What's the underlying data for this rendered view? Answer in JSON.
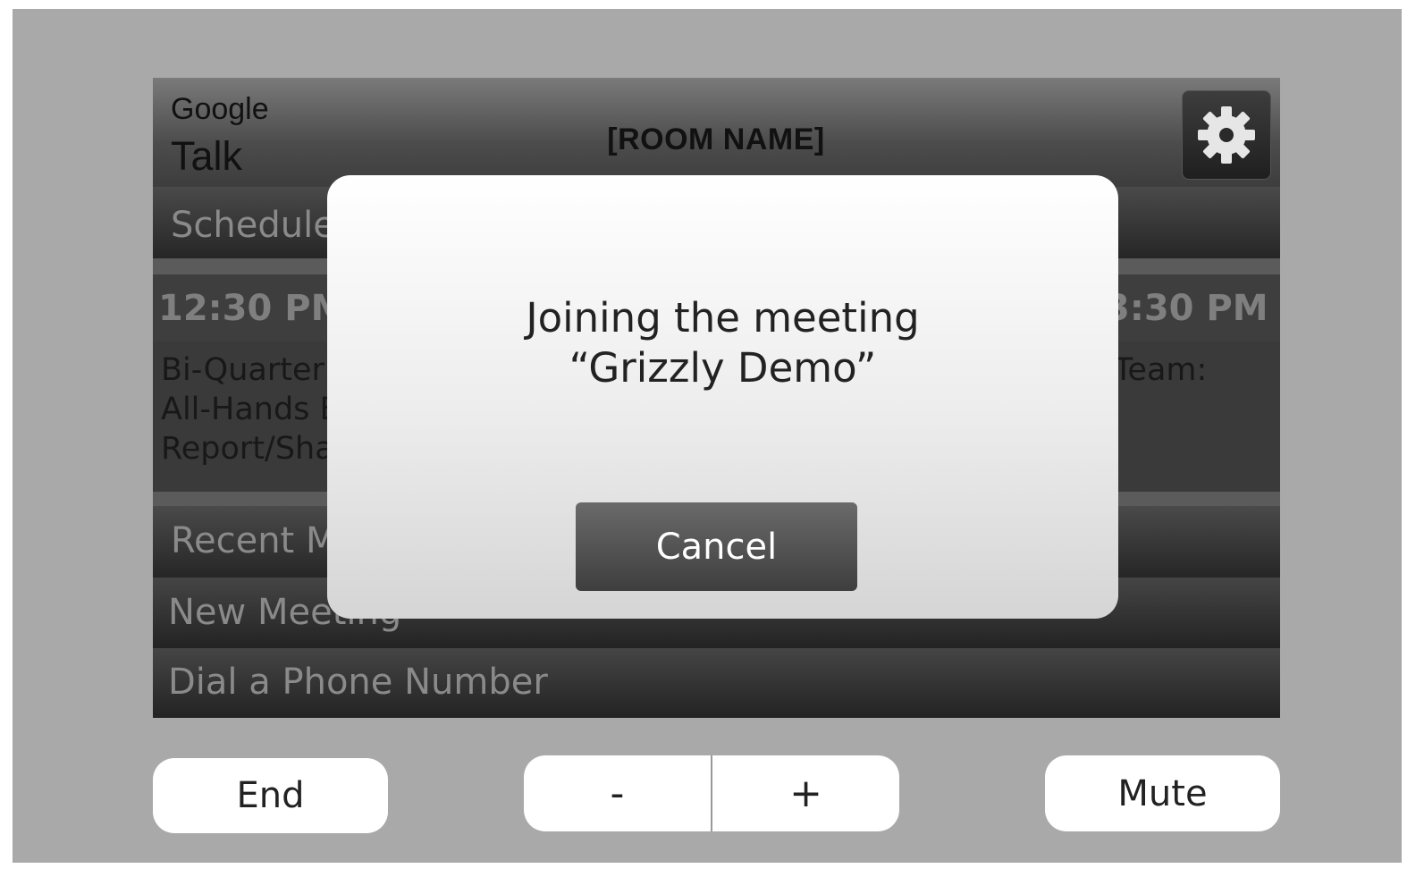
{
  "header": {
    "brand_top": "Google",
    "brand_bottom": "Talk",
    "room_name": "[ROOM NAME]",
    "settings_icon": "gear-icon"
  },
  "menu": {
    "scheduled_label": "Scheduled",
    "recent_label": "Recent Meetings",
    "new_meeting_label": "New Meeting",
    "dial_label": "Dial a Phone Number"
  },
  "schedule": {
    "left_time": "12:30 PM",
    "right_time": "3:30 PM",
    "left_meeting_lines": [
      "Bi-Quarterly",
      "All-Hands E",
      "Report/Sha"
    ],
    "right_meeting_line": "Team:"
  },
  "dialog": {
    "line1": "Joining the meeting",
    "line2": "“Grizzly Demo”",
    "cancel_label": "Cancel"
  },
  "controls": {
    "end_label": "End",
    "volume_down_label": "-",
    "volume_up_label": "+",
    "mute_label": "Mute"
  },
  "colors": {
    "frame_bg": "#a9a9a9",
    "screen_bg": "#2f2f2f",
    "dialog_bg": "#ffffff",
    "button_dark": "#4f4f4f"
  }
}
